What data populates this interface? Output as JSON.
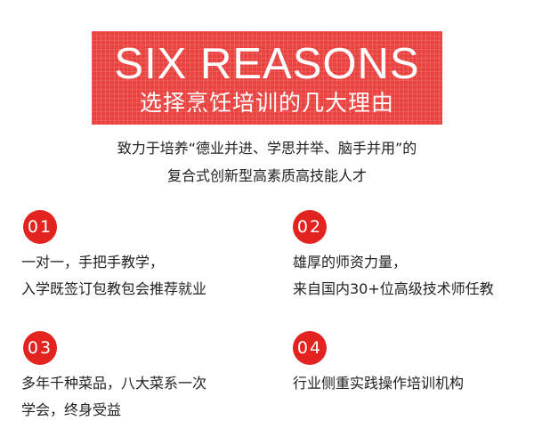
{
  "banner": {
    "title": "SIX REASONS",
    "subtitle": "选择烹饪培训的几大理由",
    "color": "#e9423f"
  },
  "intro": {
    "line1": "致力于培养“德业并进、学思并举、脑手并用”的",
    "line2": "复合式创新型高素质高技能人才"
  },
  "reasons": [
    {
      "number": "01",
      "line1": "一对一，手把手教学，",
      "line2": "入学既签订包教包会推荐就业"
    },
    {
      "number": "02",
      "line1": "雄厚的师资力量，",
      "line2": "来自国内30+位高级技术师任教"
    },
    {
      "number": "03",
      "line1": "多年千种菜品，八大菜系一次",
      "line2": "学会，终身受益"
    },
    {
      "number": "04",
      "line1": "行业侧重实践操作培训机构",
      "line2": ""
    }
  ],
  "accent_color": "#e3231f"
}
